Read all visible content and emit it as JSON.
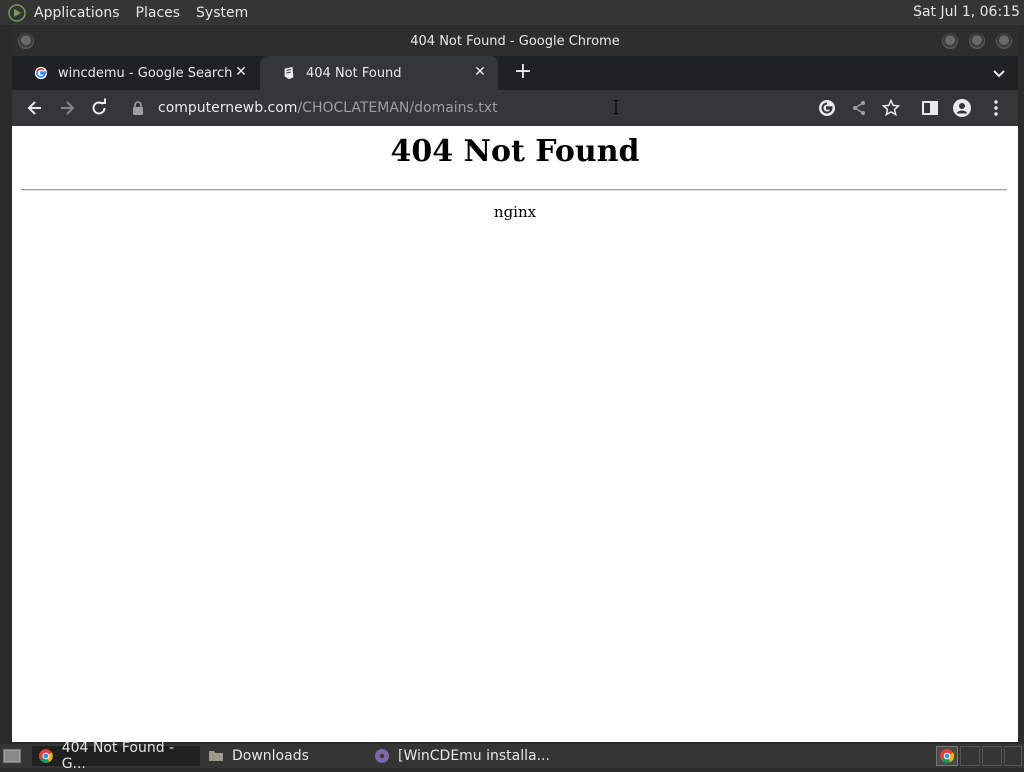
{
  "top_panel": {
    "menus": [
      "Applications",
      "Places",
      "System"
    ],
    "clock": "Sat Jul 1, 06:15"
  },
  "window": {
    "title": "404 Not Found - Google Chrome"
  },
  "tabs": [
    {
      "label": "wincdemu - Google Search",
      "favicon": "google-icon",
      "active": false
    },
    {
      "label": "404 Not Found",
      "favicon": "page-icon",
      "active": true
    }
  ],
  "toolbar": {
    "url_host": "computernewb.com",
    "url_path": "/CHOCLATEMAN/domains.txt"
  },
  "page": {
    "heading": "404 Not Found",
    "server": "nginx"
  },
  "taskbar": {
    "items": [
      {
        "label": "404 Not Found - G...",
        "icon": "chrome-icon"
      },
      {
        "label": "Downloads",
        "icon": "folder-icon"
      },
      {
        "label": "[WinCDEmu installa...",
        "icon": "disc-icon"
      }
    ]
  },
  "colors": {
    "chrome_dark": "#202124",
    "toolbar": "#35363a",
    "page_bg": "#ffffff"
  }
}
